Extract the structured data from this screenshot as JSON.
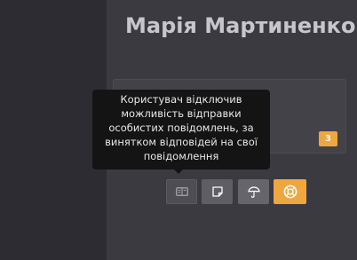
{
  "profile": {
    "name": "Марія Мартиненко"
  },
  "card": {
    "badge_count": "3"
  },
  "tooltip": {
    "text": "Користувач відключив можливість відправки особистих повідомлень, за винятком відповідей на свої повідомлення"
  },
  "actions": [
    {
      "icon": "envelope-icon",
      "state": "disabled"
    },
    {
      "icon": "note-icon"
    },
    {
      "icon": "umbrella-icon"
    },
    {
      "icon": "lifebuoy-icon",
      "state": "active"
    }
  ],
  "colors": {
    "accent": "#f0a63e",
    "background": "#3a3a40",
    "sidebar": "#2d2c33",
    "tooltip_bg": "#141414"
  }
}
